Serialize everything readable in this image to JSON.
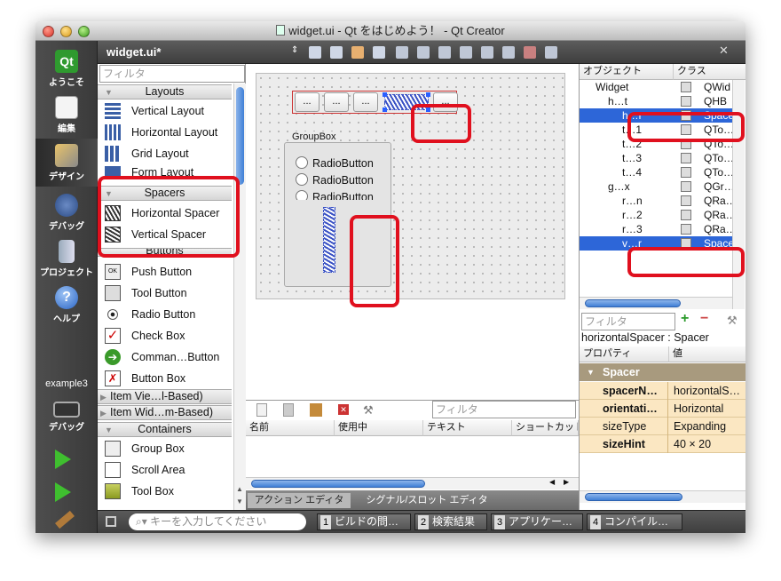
{
  "window": {
    "title": "widget.ui - Qt をはじめよう！ - Qt Creator",
    "file_icon": "ui-file-icon"
  },
  "editor_bar": {
    "file": "widget.ui*",
    "close": "✕"
  },
  "modes": [
    {
      "label": "ようこそ",
      "icon": "qt-logo-icon"
    },
    {
      "label": "編集",
      "icon": "edit-document-icon"
    },
    {
      "label": "デザイン",
      "icon": "design-pencil-icon"
    },
    {
      "label": "デバッグ",
      "icon": "debug-bug-icon"
    },
    {
      "label": "プロジェクト",
      "icon": "project-book-icon"
    },
    {
      "label": "ヘルプ",
      "icon": "help-icon"
    }
  ],
  "target": {
    "name": "example3",
    "mode": "デバッグ"
  },
  "widget_box": {
    "filter_placeholder": "フィルタ",
    "categories": {
      "layouts": "Layouts",
      "spacers": "Spacers",
      "buttons": "Buttons",
      "item_views": "Item Vie…l-Based)",
      "item_widgets": "Item Wid…m-Based)",
      "containers": "Containers"
    },
    "items": {
      "vertical_layout": "Vertical Layout",
      "horizontal_layout": "Horizontal Layout",
      "grid_layout": "Grid Layout",
      "form_layout": "Form Layout",
      "horizontal_spacer": "Horizontal Spacer",
      "vertical_spacer": "Vertical Spacer",
      "push_button": "Push Button",
      "tool_button": "Tool Button",
      "radio_button": "Radio Button",
      "check_box": "Check Box",
      "command_button": "Comman…Button",
      "button_box": "Button Box",
      "group_box": "Group Box",
      "scroll_area": "Scroll Area",
      "tool_box": "Tool Box"
    }
  },
  "form": {
    "buttons": [
      "...",
      "...",
      "...",
      "..."
    ],
    "groupbox_title": "GroupBox",
    "radios": [
      "RadioButton",
      "RadioButton",
      "RadioButton"
    ]
  },
  "action_editor": {
    "filter_placeholder": "フィルタ",
    "columns": [
      "名前",
      "使用中",
      "テキスト",
      "ショートカット"
    ],
    "tabs": [
      "アクション エディタ",
      "シグナル/スロット エディタ"
    ]
  },
  "object_inspector": {
    "columns": [
      "オブジェクト",
      "クラス"
    ],
    "rows": [
      {
        "name": "Widget",
        "cls": "QWid",
        "sel": false
      },
      {
        "name": "h…t",
        "cls": "QHB",
        "sel": false
      },
      {
        "name": "h…r",
        "cls": "Space",
        "sel": true
      },
      {
        "name": "t…1",
        "cls": "QTo…",
        "sel": false
      },
      {
        "name": "t…2",
        "cls": "QTo…",
        "sel": false
      },
      {
        "name": "t…3",
        "cls": "QTo…",
        "sel": false
      },
      {
        "name": "t…4",
        "cls": "QTo…",
        "sel": false
      },
      {
        "name": "g…x",
        "cls": "QGr…",
        "sel": false
      },
      {
        "name": "r…n",
        "cls": "QRa…",
        "sel": false
      },
      {
        "name": "r…2",
        "cls": "QRa…",
        "sel": false
      },
      {
        "name": "r…3",
        "cls": "QRa…",
        "sel": false
      },
      {
        "name": "v…r",
        "cls": "Space",
        "sel": true
      }
    ]
  },
  "property_editor": {
    "filter_placeholder": "フィルタ",
    "object_label": "horizontalSpacer : Spacer",
    "columns": [
      "プロパティ",
      "値"
    ],
    "section": "Spacer",
    "rows": [
      {
        "k": "spacerN…",
        "v": "horizontalS…",
        "bold": true
      },
      {
        "k": "orientati…",
        "v": "Horizontal",
        "bold": true
      },
      {
        "k": "sizeType",
        "v": "Expanding",
        "bold": false
      },
      {
        "k": "sizeHint",
        "v": "40 × 20",
        "bold": true
      }
    ]
  },
  "status_bar": {
    "search_placeholder": "キーを入力してください",
    "panes": [
      {
        "n": "1",
        "label": "ビルドの問…"
      },
      {
        "n": "2",
        "label": "検索結果"
      },
      {
        "n": "3",
        "label": "アプリケー…"
      },
      {
        "n": "4",
        "label": "コンパイル…"
      }
    ]
  },
  "colors": {
    "highlight": "#e0101e",
    "selection": "#2d66d8",
    "property_bg": "#fbe7c2"
  }
}
